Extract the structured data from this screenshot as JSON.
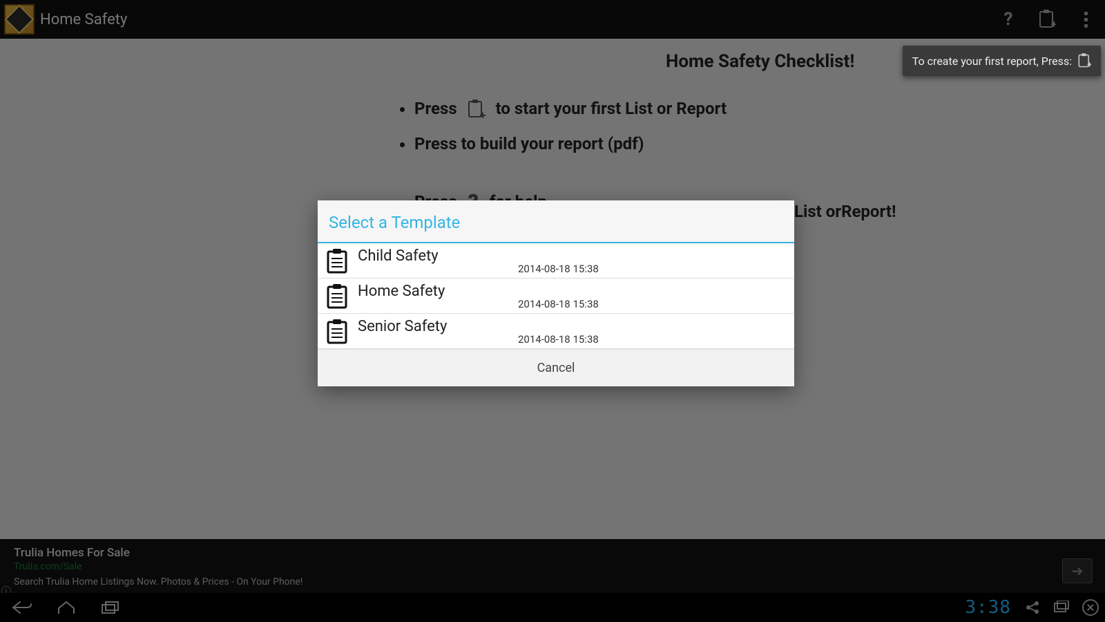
{
  "appbar": {
    "title": "Home Safety"
  },
  "bg": {
    "heading": "Home Safety Checklist!",
    "line1_a": "Press",
    "line1_b": "to start your first List or Report",
    "line2": "Press  to build your report (pdf)",
    "line3_a": "Press",
    "line3_b": "for help",
    "long_tail": "List orReport!"
  },
  "hint": {
    "text": "To create your first report, Press:"
  },
  "dialog": {
    "title": "Select a Template",
    "items": [
      {
        "title": "Child Safety",
        "date": "2014-08-18 15:38"
      },
      {
        "title": "Home Safety",
        "date": "2014-08-18 15:38"
      },
      {
        "title": "Senior Safety",
        "date": "2014-08-18 15:38"
      }
    ],
    "cancel": "Cancel"
  },
  "ad": {
    "title": "Trulia Homes For Sale",
    "url": "Trulia.com/Sale",
    "desc": "Search Trulia Home Listings Now. Photos & Prices - On Your Phone!"
  },
  "status": {
    "clock": "3:38"
  }
}
